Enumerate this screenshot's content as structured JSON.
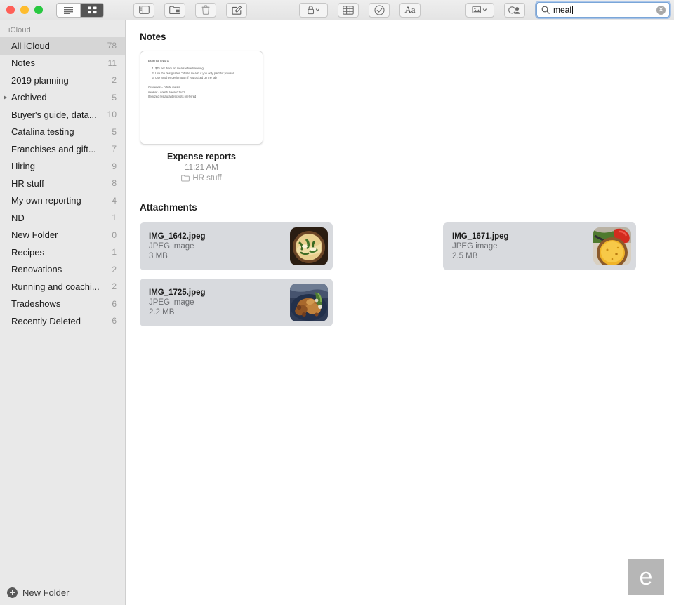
{
  "window": {
    "traffic_lights": [
      "close",
      "minimize",
      "zoom"
    ],
    "colors": {
      "close": "#ff5f57",
      "minimize": "#febc2e",
      "zoom": "#28c840",
      "accent": "#5a96e6",
      "selection": "#d6d6d6",
      "attachment_card": "#d8dade"
    }
  },
  "toolbar": {
    "view_modes": [
      {
        "name": "list-view",
        "icon": "list-icon",
        "selected": false
      },
      {
        "name": "gallery-view",
        "icon": "grid-icon",
        "selected": true
      }
    ],
    "buttons": [
      {
        "name": "sidebar-toggle",
        "icon": "sidebar-icon"
      },
      {
        "name": "new-folder",
        "icon": "folder-add-icon"
      },
      {
        "name": "delete-note",
        "icon": "trash-icon"
      },
      {
        "name": "compose-note",
        "icon": "compose-icon"
      },
      {
        "name": "lock-note",
        "icon": "lock-icon"
      },
      {
        "name": "insert-table",
        "icon": "table-icon"
      },
      {
        "name": "checklist",
        "icon": "checkmark-circle-icon"
      },
      {
        "name": "text-format",
        "icon": "aa-icon",
        "label": "Aa"
      },
      {
        "name": "insert-media",
        "icon": "photo-icon"
      },
      {
        "name": "add-people",
        "icon": "add-person-icon"
      },
      {
        "name": "share",
        "icon": "share-icon"
      }
    ],
    "search": {
      "value": "meal",
      "placeholder": "Search",
      "icon": "search-icon",
      "clear_icon": "clear-circle-icon",
      "clear_glyph": "✕",
      "focused": true
    }
  },
  "sidebar": {
    "header": "iCloud",
    "items": [
      {
        "label": "All iCloud",
        "count": "78",
        "selected": true,
        "expandable": false
      },
      {
        "label": "Notes",
        "count": "11",
        "selected": false,
        "expandable": false
      },
      {
        "label": "2019 planning",
        "count": "2",
        "selected": false,
        "expandable": false
      },
      {
        "label": "Archived",
        "count": "5",
        "selected": false,
        "expandable": true
      },
      {
        "label": "Buyer's guide, data...",
        "count": "10",
        "selected": false,
        "expandable": false
      },
      {
        "label": "Catalina testing",
        "count": "5",
        "selected": false,
        "expandable": false
      },
      {
        "label": "Franchises and gift...",
        "count": "7",
        "selected": false,
        "expandable": false
      },
      {
        "label": "Hiring",
        "count": "9",
        "selected": false,
        "expandable": false
      },
      {
        "label": "HR stuff",
        "count": "8",
        "selected": false,
        "expandable": false
      },
      {
        "label": "My own reporting",
        "count": "4",
        "selected": false,
        "expandable": false
      },
      {
        "label": "ND",
        "count": "1",
        "selected": false,
        "expandable": false
      },
      {
        "label": "New Folder",
        "count": "0",
        "selected": false,
        "expandable": false
      },
      {
        "label": "Recipes",
        "count": "1",
        "selected": false,
        "expandable": false
      },
      {
        "label": "Renovations",
        "count": "2",
        "selected": false,
        "expandable": false
      },
      {
        "label": "Running and coachi...",
        "count": "2",
        "selected": false,
        "expandable": false
      },
      {
        "label": "Tradeshows",
        "count": "6",
        "selected": false,
        "expandable": false
      },
      {
        "label": "Recently Deleted",
        "count": "6",
        "selected": false,
        "expandable": false
      }
    ],
    "footer": {
      "label": "New Folder",
      "icon": "plus-circle-icon"
    }
  },
  "main": {
    "notes_heading": "Notes",
    "notes": [
      {
        "title": "Expense reports",
        "time": "11:21 AM",
        "folder": "HR stuff",
        "folder_icon": "folder-icon",
        "preview": {
          "heading": "Expense reports",
          "list": [
            "$75 per diem on meals while traveling",
            "Use the designation \"offsite meals\" if you only paid for yourself",
            "Use another designation if you picked up the tab"
          ],
          "lines": [
            "Groceries = offsite meals",
            "minibar - counts toward food",
            "Itemized restaurant receipts preferred"
          ]
        }
      }
    ],
    "attachments_heading": "Attachments",
    "attachments": [
      {
        "name": "IMG_1642.jpeg",
        "kind": "JPEG image",
        "size": "3 MB",
        "thumb": "pasta-bowl"
      },
      {
        "name": "IMG_1671.jpeg",
        "kind": "JPEG image",
        "size": "2.5 MB",
        "thumb": "yellow-dish"
      },
      {
        "name": "IMG_1725.jpeg",
        "kind": "JPEG image",
        "size": "2.2 MB",
        "thumb": "roast-chicken"
      }
    ]
  },
  "watermark": {
    "letter": "e"
  }
}
